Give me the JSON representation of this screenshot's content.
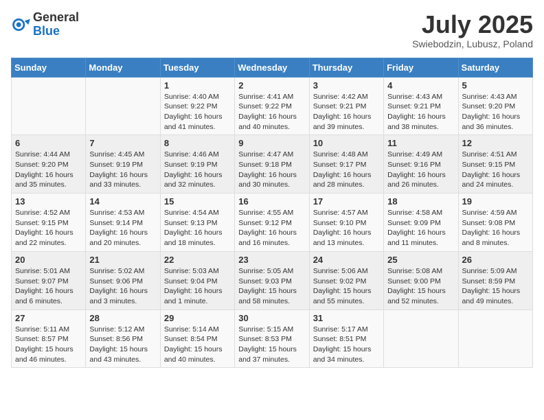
{
  "header": {
    "logo_general": "General",
    "logo_blue": "Blue",
    "month_title": "July 2025",
    "location": "Swiebodzin, Lubusz, Poland"
  },
  "weekdays": [
    "Sunday",
    "Monday",
    "Tuesday",
    "Wednesday",
    "Thursday",
    "Friday",
    "Saturday"
  ],
  "weeks": [
    [
      {
        "day": "",
        "info": ""
      },
      {
        "day": "",
        "info": ""
      },
      {
        "day": "1",
        "info": "Sunrise: 4:40 AM\nSunset: 9:22 PM\nDaylight: 16 hours and 41 minutes."
      },
      {
        "day": "2",
        "info": "Sunrise: 4:41 AM\nSunset: 9:22 PM\nDaylight: 16 hours and 40 minutes."
      },
      {
        "day": "3",
        "info": "Sunrise: 4:42 AM\nSunset: 9:21 PM\nDaylight: 16 hours and 39 minutes."
      },
      {
        "day": "4",
        "info": "Sunrise: 4:43 AM\nSunset: 9:21 PM\nDaylight: 16 hours and 38 minutes."
      },
      {
        "day": "5",
        "info": "Sunrise: 4:43 AM\nSunset: 9:20 PM\nDaylight: 16 hours and 36 minutes."
      }
    ],
    [
      {
        "day": "6",
        "info": "Sunrise: 4:44 AM\nSunset: 9:20 PM\nDaylight: 16 hours and 35 minutes."
      },
      {
        "day": "7",
        "info": "Sunrise: 4:45 AM\nSunset: 9:19 PM\nDaylight: 16 hours and 33 minutes."
      },
      {
        "day": "8",
        "info": "Sunrise: 4:46 AM\nSunset: 9:19 PM\nDaylight: 16 hours and 32 minutes."
      },
      {
        "day": "9",
        "info": "Sunrise: 4:47 AM\nSunset: 9:18 PM\nDaylight: 16 hours and 30 minutes."
      },
      {
        "day": "10",
        "info": "Sunrise: 4:48 AM\nSunset: 9:17 PM\nDaylight: 16 hours and 28 minutes."
      },
      {
        "day": "11",
        "info": "Sunrise: 4:49 AM\nSunset: 9:16 PM\nDaylight: 16 hours and 26 minutes."
      },
      {
        "day": "12",
        "info": "Sunrise: 4:51 AM\nSunset: 9:15 PM\nDaylight: 16 hours and 24 minutes."
      }
    ],
    [
      {
        "day": "13",
        "info": "Sunrise: 4:52 AM\nSunset: 9:15 PM\nDaylight: 16 hours and 22 minutes."
      },
      {
        "day": "14",
        "info": "Sunrise: 4:53 AM\nSunset: 9:14 PM\nDaylight: 16 hours and 20 minutes."
      },
      {
        "day": "15",
        "info": "Sunrise: 4:54 AM\nSunset: 9:13 PM\nDaylight: 16 hours and 18 minutes."
      },
      {
        "day": "16",
        "info": "Sunrise: 4:55 AM\nSunset: 9:12 PM\nDaylight: 16 hours and 16 minutes."
      },
      {
        "day": "17",
        "info": "Sunrise: 4:57 AM\nSunset: 9:10 PM\nDaylight: 16 hours and 13 minutes."
      },
      {
        "day": "18",
        "info": "Sunrise: 4:58 AM\nSunset: 9:09 PM\nDaylight: 16 hours and 11 minutes."
      },
      {
        "day": "19",
        "info": "Sunrise: 4:59 AM\nSunset: 9:08 PM\nDaylight: 16 hours and 8 minutes."
      }
    ],
    [
      {
        "day": "20",
        "info": "Sunrise: 5:01 AM\nSunset: 9:07 PM\nDaylight: 16 hours and 6 minutes."
      },
      {
        "day": "21",
        "info": "Sunrise: 5:02 AM\nSunset: 9:06 PM\nDaylight: 16 hours and 3 minutes."
      },
      {
        "day": "22",
        "info": "Sunrise: 5:03 AM\nSunset: 9:04 PM\nDaylight: 16 hours and 1 minute."
      },
      {
        "day": "23",
        "info": "Sunrise: 5:05 AM\nSunset: 9:03 PM\nDaylight: 15 hours and 58 minutes."
      },
      {
        "day": "24",
        "info": "Sunrise: 5:06 AM\nSunset: 9:02 PM\nDaylight: 15 hours and 55 minutes."
      },
      {
        "day": "25",
        "info": "Sunrise: 5:08 AM\nSunset: 9:00 PM\nDaylight: 15 hours and 52 minutes."
      },
      {
        "day": "26",
        "info": "Sunrise: 5:09 AM\nSunset: 8:59 PM\nDaylight: 15 hours and 49 minutes."
      }
    ],
    [
      {
        "day": "27",
        "info": "Sunrise: 5:11 AM\nSunset: 8:57 PM\nDaylight: 15 hours and 46 minutes."
      },
      {
        "day": "28",
        "info": "Sunrise: 5:12 AM\nSunset: 8:56 PM\nDaylight: 15 hours and 43 minutes."
      },
      {
        "day": "29",
        "info": "Sunrise: 5:14 AM\nSunset: 8:54 PM\nDaylight: 15 hours and 40 minutes."
      },
      {
        "day": "30",
        "info": "Sunrise: 5:15 AM\nSunset: 8:53 PM\nDaylight: 15 hours and 37 minutes."
      },
      {
        "day": "31",
        "info": "Sunrise: 5:17 AM\nSunset: 8:51 PM\nDaylight: 15 hours and 34 minutes."
      },
      {
        "day": "",
        "info": ""
      },
      {
        "day": "",
        "info": ""
      }
    ]
  ]
}
